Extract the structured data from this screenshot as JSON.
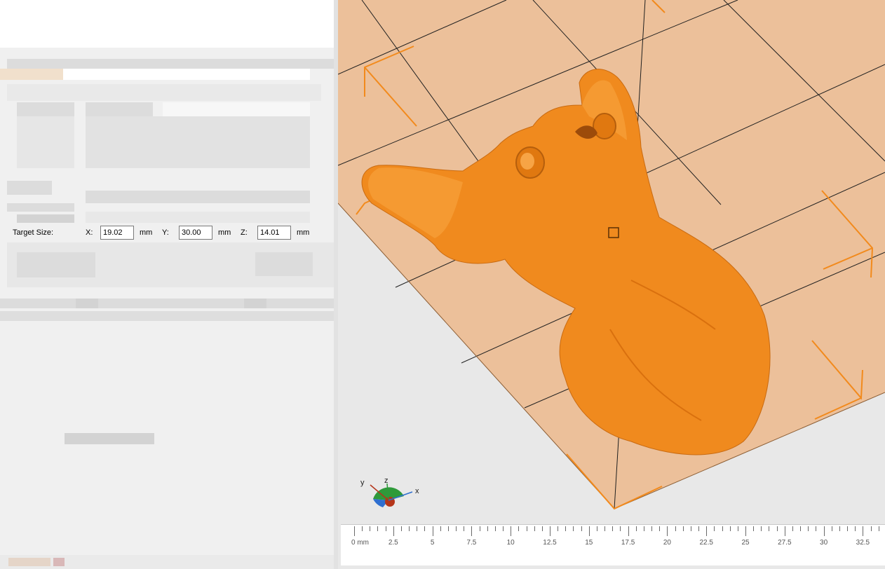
{
  "target_size": {
    "label": "Target Size:",
    "x_label": "X:",
    "x_value": "19.02",
    "y_label": "Y:",
    "y_value": "30.00",
    "z_label": "Z:",
    "z_value": "14.01",
    "unit": "mm"
  },
  "axis_widget": {
    "x": "x",
    "y": "y",
    "z": "z"
  },
  "ruler": {
    "ticks": [
      "0 mm",
      "2.5",
      "5",
      "7.5",
      "10",
      "12.5",
      "15",
      "17.5",
      "20",
      "22.5",
      "25",
      "27.5",
      "30",
      "32.5"
    ]
  },
  "colors": {
    "model": "#f08a1e",
    "bed": "#ecc09a",
    "frame": "#f28a1c"
  },
  "icons": [
    "move-handle-icon",
    "axis-orientation-icon"
  ]
}
